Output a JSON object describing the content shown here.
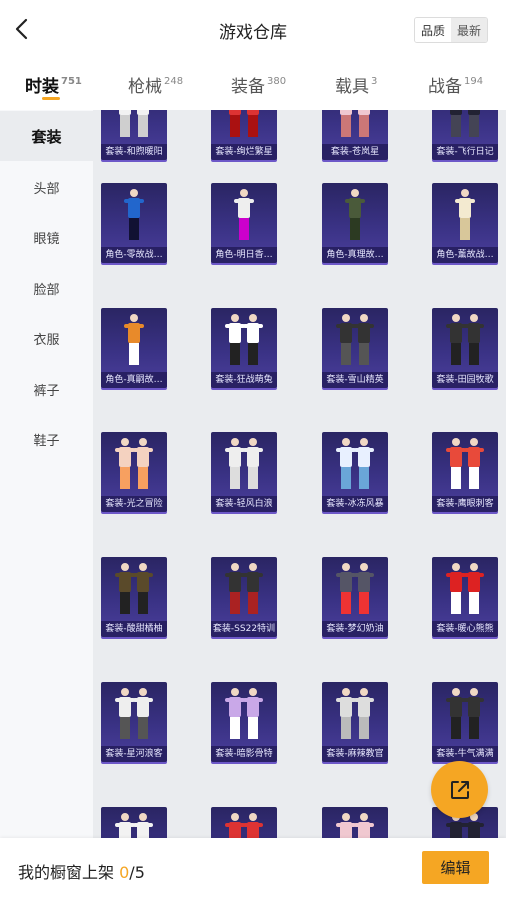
{
  "header": {
    "title": "游戏仓库",
    "sort_options": [
      "品质",
      "最新"
    ],
    "sort_selected": "最新"
  },
  "tabs": [
    {
      "label": "时装",
      "count": "751",
      "active": true
    },
    {
      "label": "枪械",
      "count": "248",
      "active": false
    },
    {
      "label": "装备",
      "count": "380",
      "active": false
    },
    {
      "label": "载具",
      "count": "3",
      "active": false
    },
    {
      "label": "战备",
      "count": "194",
      "active": false
    }
  ],
  "sidebar": {
    "items": [
      {
        "label": "套装",
        "active": true
      },
      {
        "label": "头部",
        "active": false
      },
      {
        "label": "眼镜",
        "active": false
      },
      {
        "label": "脸部",
        "active": false
      },
      {
        "label": "衣服",
        "active": false
      },
      {
        "label": "裤子",
        "active": false
      },
      {
        "label": "鞋子",
        "active": false
      }
    ]
  },
  "grid": {
    "rows": [
      [
        "套装-和煦暖阳",
        "套装-绚烂繁星",
        "套装-苍岚星",
        "套装-飞行日记"
      ],
      [
        "角色-零故战…",
        "角色-明日香…",
        "角色-真理故…",
        "角色-薰故战…"
      ],
      [
        "角色-真嗣故…",
        "套装-狂战萌兔",
        "套装-雪山精英",
        "套装-田园牧歌"
      ],
      [
        "套装-光之冒险",
        "套装-轻风白浪",
        "套装-冰冻风暴",
        "套装-鹰眼刺客"
      ],
      [
        "套装-酸甜橘柚",
        "套装-SS22特训",
        "套装-梦幻奶油",
        "套装-暖心熊熊"
      ],
      [
        "套装-星河浪客",
        "套装-暗影骨特",
        "套装-麻辣教官",
        "套装-牛气满满"
      ],
      [
        "",
        "",
        "",
        ""
      ]
    ]
  },
  "bottom": {
    "text": "我的橱窗上架",
    "current": "0",
    "separator": "/",
    "total": "5",
    "edit_label": "编辑"
  },
  "colors": {
    "accent": "#f5a623",
    "card_top": "#2a2563",
    "card_bottom": "#4b3f9c"
  },
  "icons": {
    "back": "chevron-left-icon",
    "share": "external-link-icon"
  }
}
